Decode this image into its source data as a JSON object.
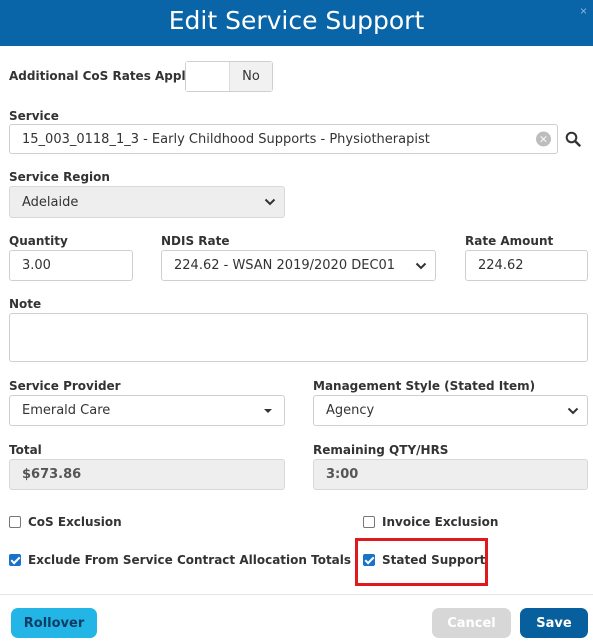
{
  "dialog": {
    "title": "Edit Service Support",
    "close": "×"
  },
  "cos_rates": {
    "label": "Additional CoS Rates Apply",
    "value": "No"
  },
  "service": {
    "label": "Service",
    "value": "15_003_0118_1_3 - Early Childhood Supports - Physiotherapist",
    "clear": "×"
  },
  "service_region": {
    "label": "Service Region",
    "value": "Adelaide"
  },
  "quantity": {
    "label": "Quantity",
    "value": "3.00"
  },
  "ndis_rate": {
    "label": "NDIS Rate",
    "value": "224.62 - WSAN 2019/2020 DEC01"
  },
  "rate_amount": {
    "label": "Rate Amount",
    "value": "224.62"
  },
  "note": {
    "label": "Note",
    "value": ""
  },
  "service_provider": {
    "label": "Service Provider",
    "value": "Emerald Care"
  },
  "management_style": {
    "label": "Management Style (Stated Item)",
    "value": "Agency"
  },
  "total": {
    "label": "Total",
    "value": "$673.86"
  },
  "remaining": {
    "label": "Remaining QTY/HRS",
    "value": "3:00"
  },
  "checkboxes": {
    "cos_exclusion": {
      "label": "CoS Exclusion",
      "checked": false
    },
    "invoice_exclusion": {
      "label": "Invoice Exclusion",
      "checked": false
    },
    "exclude_allocation": {
      "label": "Exclude From Service Contract Allocation Totals",
      "checked": true
    },
    "stated_support": {
      "label": "Stated Support",
      "checked": true
    }
  },
  "buttons": {
    "rollover": "Rollover",
    "cancel": "Cancel",
    "save": "Save"
  },
  "colors": {
    "header": "#0a65a8",
    "highlight": "#e0191e",
    "rollover": "#22b5e5",
    "save": "#075f9e",
    "checkbox": "#1a73c8"
  }
}
